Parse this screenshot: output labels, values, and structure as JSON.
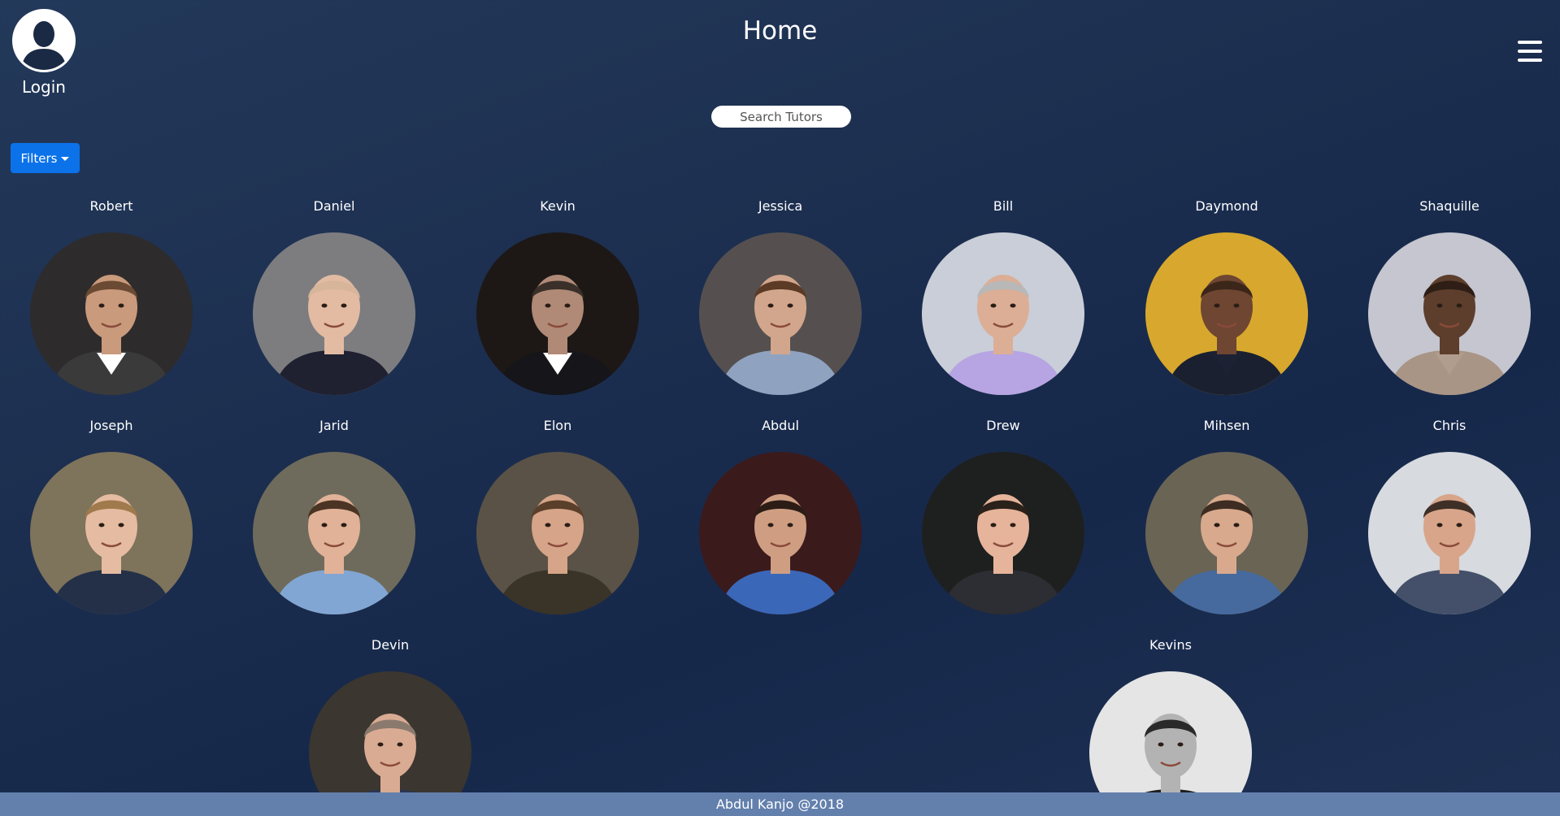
{
  "header": {
    "title": "Home",
    "login_label": "Login",
    "menu_icon": "hamburger-menu-icon",
    "avatar_icon": "user-silhouette-icon"
  },
  "search": {
    "placeholder": "Search Tutors",
    "value": ""
  },
  "filters": {
    "label": "Filters"
  },
  "tutors": [
    {
      "name": "Robert",
      "bg": "#2e2b2c",
      "skin": "#c99a7c",
      "hair": "#6b4a33",
      "shirt": "#ffffff",
      "jacket": "#3a3a3a"
    },
    {
      "name": "Daniel",
      "bg": "#7d7d80",
      "skin": "#e2bba2",
      "hair": "#d6b59b",
      "shirt": "#1f2030",
      "jacket": "#1f2030"
    },
    {
      "name": "Kevin",
      "bg": "#1d1816",
      "skin": "#b08a76",
      "hair": "#3a3029",
      "shirt": "#ffffff",
      "jacket": "#15151a"
    },
    {
      "name": "Jessica",
      "bg": "#55504f",
      "skin": "#d2a68c",
      "hair": "#5b3a26",
      "shirt": "#8fa3c0",
      "jacket": "#8fa3c0"
    },
    {
      "name": "Bill",
      "bg": "#c9ced8",
      "skin": "#dcae95",
      "hair": "#b8b8b8",
      "shirt": "#b7a4e2",
      "jacket": "#b7a4e2"
    },
    {
      "name": "Daymond",
      "bg": "#d7a82d",
      "skin": "#6e4631",
      "hair": "#3c261a",
      "shirt": "#1c2233",
      "jacket": "#1a2030"
    },
    {
      "name": "Shaquille",
      "bg": "#c5c6cf",
      "skin": "#5d3e2c",
      "hair": "#2e1e15",
      "shirt": "#b09d8e",
      "jacket": "#a99585"
    },
    {
      "name": "Joseph",
      "bg": "#7e735b",
      "skin": "#e5bba2",
      "hair": "#a07a4c",
      "shirt": "#233047",
      "jacket": "#233047"
    },
    {
      "name": "Jarid",
      "bg": "#6f6b5c",
      "skin": "#e1b298",
      "hair": "#4b3424",
      "shirt": "#82a6d4",
      "jacket": "#82a6d4"
    },
    {
      "name": "Elon",
      "bg": "#5a5246",
      "skin": "#d6a488",
      "hair": "#5a3f2a",
      "shirt": "#3a3327",
      "jacket": "#3a3327"
    },
    {
      "name": "Abdul",
      "bg": "#3b1a1c",
      "skin": "#cf9e82",
      "hair": "#2b1d16",
      "shirt": "#3b67b8",
      "jacket": "#3b67b8"
    },
    {
      "name": "Drew",
      "bg": "#1e2020",
      "skin": "#e6b49a",
      "hair": "#2a211a",
      "shirt": "#2d2e33",
      "jacket": "#2d2e33"
    },
    {
      "name": "Mihsen",
      "bg": "#6a6455",
      "skin": "#d8a98c",
      "hair": "#3d2c22",
      "shirt": "#466a9e",
      "jacket": "#466a9e"
    },
    {
      "name": "Chris",
      "bg": "#d7dadf",
      "skin": "#d8a58a",
      "hair": "#3e2f27",
      "shirt": "#445069",
      "jacket": "#445069"
    },
    {
      "name": "Devin",
      "bg": "#3b3630",
      "skin": "#d9ab92",
      "hair": "#8a7a6e",
      "shirt": "#2b3552",
      "jacket": "#2b3552"
    },
    {
      "name": "Kevins",
      "bg": "#e5e5e5",
      "skin": "#b3b3b3",
      "hair": "#2a2a2a",
      "shirt": "#1e1e1e",
      "jacket": "#1e1e1e"
    }
  ],
  "footer": {
    "text": "Abdul Kanjo @2018"
  }
}
